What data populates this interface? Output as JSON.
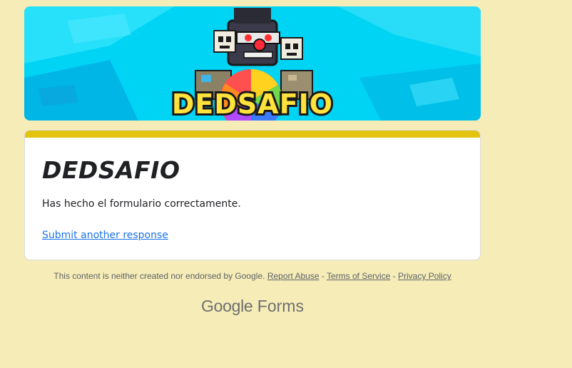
{
  "banner": {
    "logo_text": "DEDSAFIO"
  },
  "form": {
    "title": "DEDSAFIO",
    "confirmation_message": "Has hecho el formulario correctamente.",
    "submit_another_label": "Submit another response"
  },
  "footer": {
    "disclaimer": "This content is neither created nor endorsed by Google.",
    "report_abuse": "Report Abuse",
    "terms": "Terms of Service",
    "privacy": "Privacy Policy",
    "separator": " - "
  },
  "brand": {
    "google": "Google",
    "forms": "Forms"
  },
  "colors": {
    "page_background": "#f5ecb7",
    "card_accent": "#e2c30e",
    "link": "#1a73e8",
    "banner_sky": "#00d4f5"
  }
}
